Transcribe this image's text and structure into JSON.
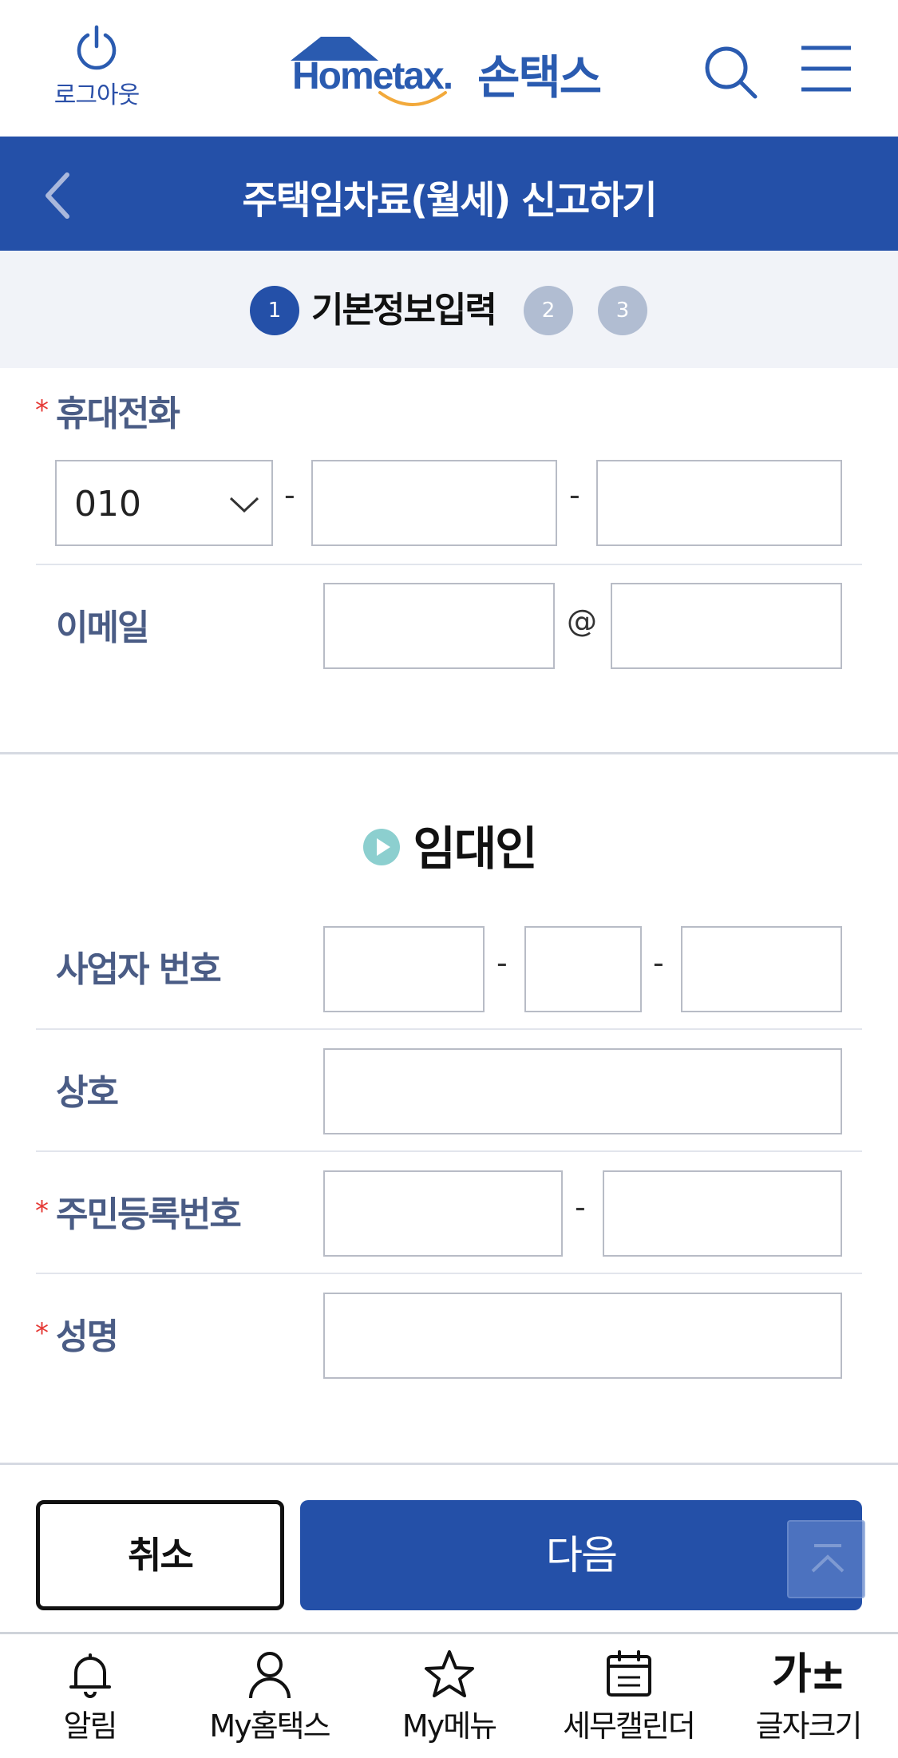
{
  "header": {
    "logout_label": "로그아웃",
    "logo_text": "Hometax.",
    "logo_korean": "손택스"
  },
  "titlebar": {
    "title": "주택임차료(월세) 신고하기"
  },
  "steps": {
    "current_number": "1",
    "current_label": "기본정보입력",
    "step2": "2",
    "step3": "3"
  },
  "contact": {
    "phone_label": "휴대전화",
    "phone_prefix": "010",
    "phone_sep1": "-",
    "phone_sep2": "-",
    "email_label": "이메일",
    "email_at": "@"
  },
  "landlord": {
    "section_title": "임대인",
    "bizno_label": "사업자 번호",
    "bizno_sep1": "-",
    "bizno_sep2": "-",
    "company_label": "상호",
    "rrn_label": "주민등록번호",
    "rrn_sep": "-",
    "name_label": "성명"
  },
  "required_mark": "*",
  "actions": {
    "cancel": "취소",
    "next": "다음"
  },
  "bottom_nav": [
    {
      "label": "알림",
      "icon": "bell-icon"
    },
    {
      "label": "My홈택스",
      "icon": "person-icon"
    },
    {
      "label": "My메뉴",
      "icon": "star-icon"
    },
    {
      "label": "세무캘린더",
      "icon": "calendar-icon"
    },
    {
      "label": "글자크기",
      "icon_text": "가±"
    }
  ],
  "colors": {
    "primary": "#2450a8",
    "label": "#4a5c85",
    "required": "#e53935",
    "step_inactive": "#b1bdd2",
    "steps_bg": "#f1f3f8"
  }
}
